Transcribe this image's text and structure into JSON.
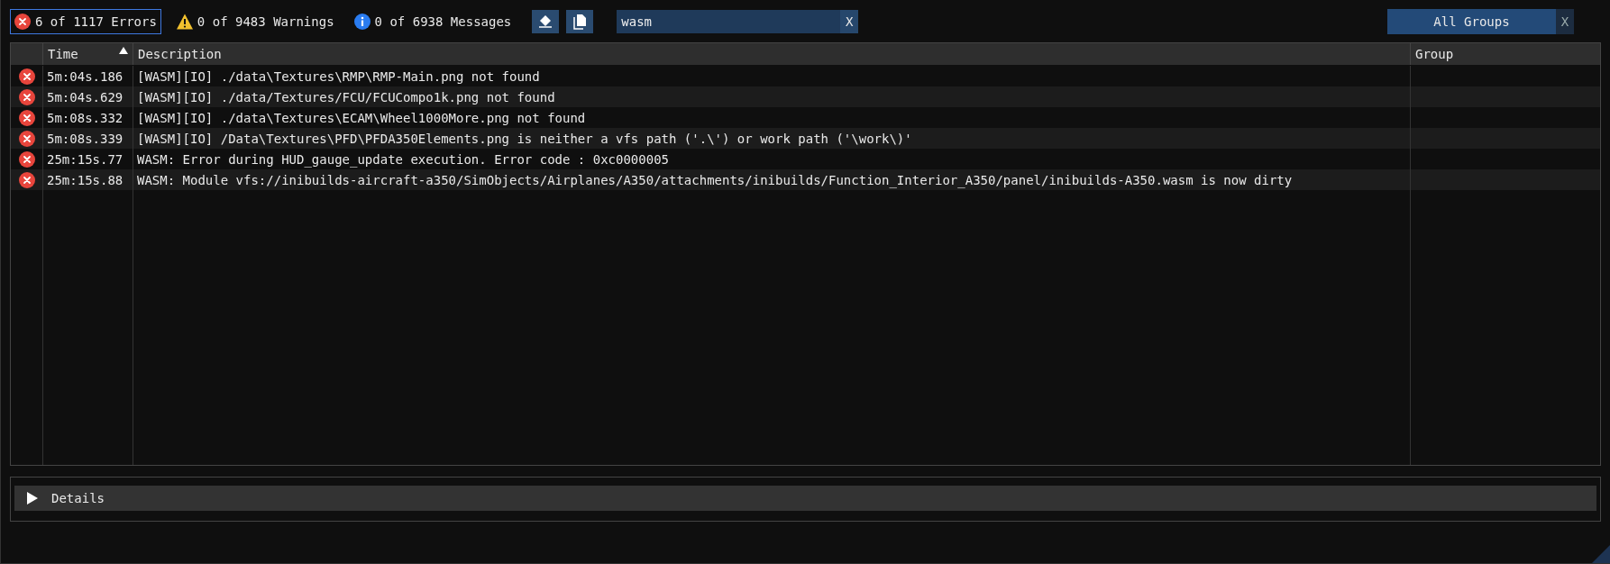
{
  "filters": [
    {
      "kind": "error",
      "label": "6 of 1117 Errors",
      "selected": true
    },
    {
      "kind": "warning",
      "label": "0 of 9483 Warnings",
      "selected": false
    },
    {
      "kind": "info",
      "label": "0 of 6938 Messages",
      "selected": false
    }
  ],
  "search": {
    "value": "wasm",
    "clear": "X"
  },
  "group_filter": {
    "label": "All Groups",
    "clear": "X"
  },
  "table": {
    "columns": [
      {
        "label": "Time",
        "sorted": true
      },
      {
        "label": "Description",
        "sorted": false
      },
      {
        "label": "Group",
        "sorted": false
      }
    ],
    "rows": [
      {
        "kind": "error",
        "time": "5m:04s.186",
        "description": "[WASM][IO] ./data\\Textures\\RMP\\RMP-Main.png not found"
      },
      {
        "kind": "error",
        "time": "5m:04s.629",
        "description": "[WASM][IO] ./data/Textures/FCU/FCUCompo1k.png not found"
      },
      {
        "kind": "error",
        "time": "5m:08s.332",
        "description": "[WASM][IO] ./data\\Textures\\ECAM\\Wheel1000More.png not found"
      },
      {
        "kind": "error",
        "time": "5m:08s.339",
        "description": "[WASM][IO] /Data\\Textures\\PFD\\PFDA350Elements.png is neither a vfs path ('.\\') or work path ('\\work\\)'"
      },
      {
        "kind": "error",
        "time": "25m:15s.77",
        "description": "WASM: Error during HUD_gauge_update execution. Error code : 0xc0000005"
      },
      {
        "kind": "error",
        "time": "25m:15s.88",
        "description": "WASM: Module vfs://inibuilds-aircraft-a350/SimObjects/Airplanes/A350/attachments/inibuilds/Function_Interior_A350/panel/inibuilds-A350.wasm is now dirty"
      }
    ]
  },
  "details": {
    "label": "Details",
    "expanded": false
  }
}
